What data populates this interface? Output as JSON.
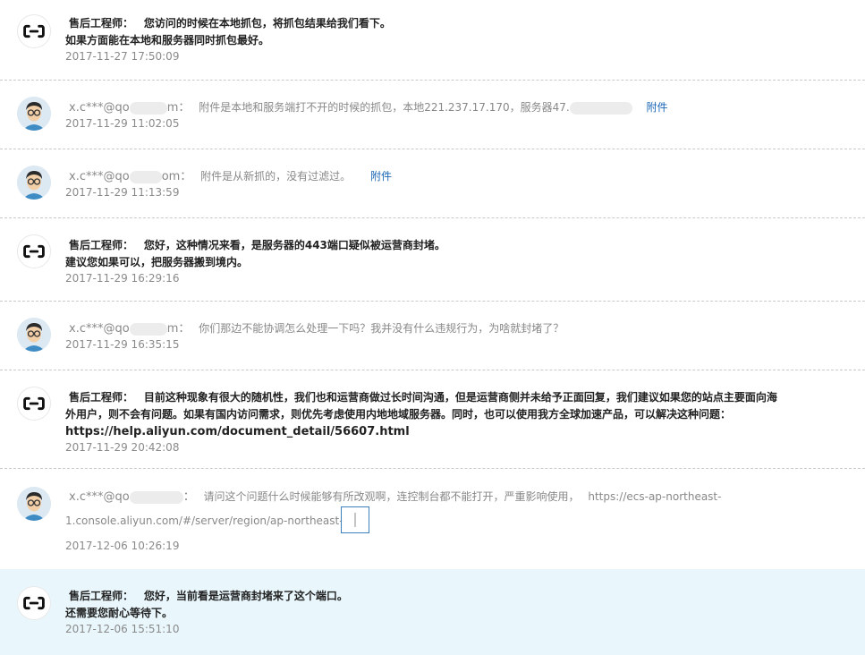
{
  "labels": {
    "engineer": "售后工程师：",
    "user_name_prefix": "x.c***@qo",
    "user_name_suffix_1": "m：",
    "user_name_suffix_2": "om：",
    "user_name_suffix_3": "m：",
    "user_name_suffix_4": "：",
    "attachment": "附件"
  },
  "messages": [
    {
      "content_line1": "您访问的时候在本地抓包，将抓包结果给我们看下。",
      "content_line2": "如果方面能在本地和服务器同时抓包最好。",
      "time": "2017-11-27 17:50:09"
    },
    {
      "content": "附件是本地和服务端打不开的时候的抓包，本地221.237.17.170，服务器47.",
      "time": "2017-11-29 11:02:05"
    },
    {
      "content": "附件是从新抓的，没有过滤过。",
      "time": "2017-11-29 11:13:59"
    },
    {
      "content_line1": "您好，这种情况来看，是服务器的443端口疑似被运营商封堵。",
      "content_line2": "建议您如果可以，把服务器搬到境内。",
      "time": "2017-11-29 16:29:16"
    },
    {
      "content": "你们那边不能协调怎么处理一下吗？我并没有什么违规行为，为啥就封堵了？",
      "time": "2017-11-29 16:35:15"
    },
    {
      "content_line1": "目前这种现象有很大的随机性，我们也和运营商做过长时间沟通，但是运营商侧并未给予正面回复，我们建议如果您的站点主要面向海",
      "content_line2": "外用户，则不会有问题。如果有国内访问需求，则优先考虑使用内地地域服务器。同时，也可以使用我方全球加速产品，可以解决这种问题：",
      "url": "https://help.aliyun.com/document_detail/56607.html",
      "time": "2017-11-29 20:42:08"
    },
    {
      "content": "请问这个问题什么时候能够有所改观啊，连控制台都不能打开，严重影响使用，",
      "url_part1": "https://ecs-ap-northeast-",
      "url_part2": "1.console.aliyun.com/#/server/region/ap-northeast-1",
      "time": "2017-12-06 10:26:19"
    },
    {
      "content_line1": "您好，当前看是运营商封堵来了这个端口。",
      "content_line2": "还需要您耐心等待下。",
      "time": "2017-12-06 15:51:10"
    }
  ],
  "colors": {
    "highlight_bg": "#e9f7fc",
    "link": "#1a66b5",
    "muted_text": "#8a8a8a"
  },
  "icons": {
    "engineer_avatar": "aliyun-logo-icon",
    "user_avatar": "user-cartoon-avatar-icon",
    "attachment_thumb": "image-thumbnail-icon"
  }
}
